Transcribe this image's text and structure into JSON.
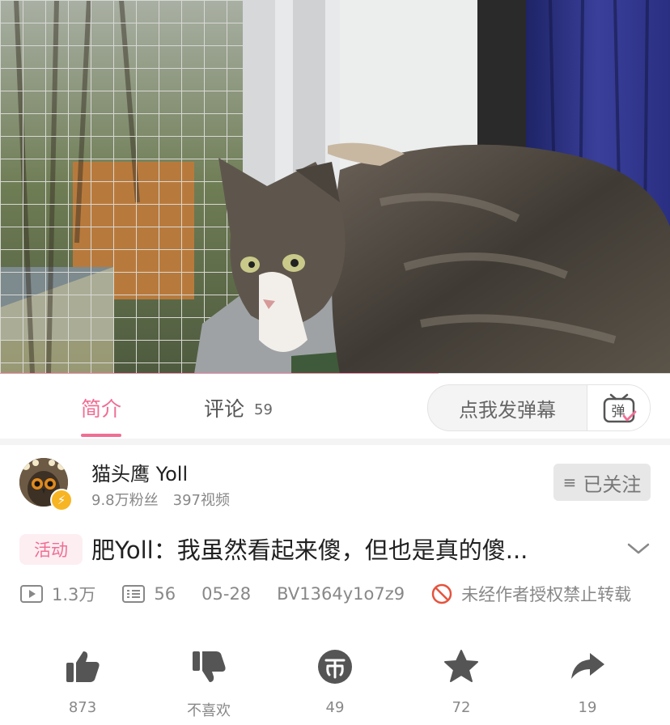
{
  "video": {
    "progress_fraction": 0.655
  },
  "tabs": {
    "intro_label": "简介",
    "comments_label": "评论",
    "comments_count": "59"
  },
  "danmaku": {
    "placeholder": "点我发弹幕",
    "button_glyph": "弹"
  },
  "uploader": {
    "name": "猫头鹰 Yoll",
    "followers": "9.8万粉丝",
    "videos": "397视频",
    "follow_label": "已关注",
    "follow_menu_glyph": "≡"
  },
  "video_info": {
    "tag": "活动",
    "title": "肥Yoll：我虽然看起来傻，但也是真的傻...",
    "plays": "1.3万",
    "danmaku_count": "56",
    "date": "05-28",
    "bvid": "BV1364y1o7z9",
    "copyright": "未经作者授权禁止转载"
  },
  "actions": [
    {
      "icon": "thumbs-up-icon",
      "label": "873"
    },
    {
      "icon": "thumbs-down-icon",
      "label": "不喜欢"
    },
    {
      "icon": "coin-icon",
      "label": "49"
    },
    {
      "icon": "star-icon",
      "label": "72"
    },
    {
      "icon": "share-icon",
      "label": "19"
    }
  ],
  "colors": {
    "accent": "#ef6e94",
    "progress": "#f08fae",
    "gray_text": "#888888"
  }
}
